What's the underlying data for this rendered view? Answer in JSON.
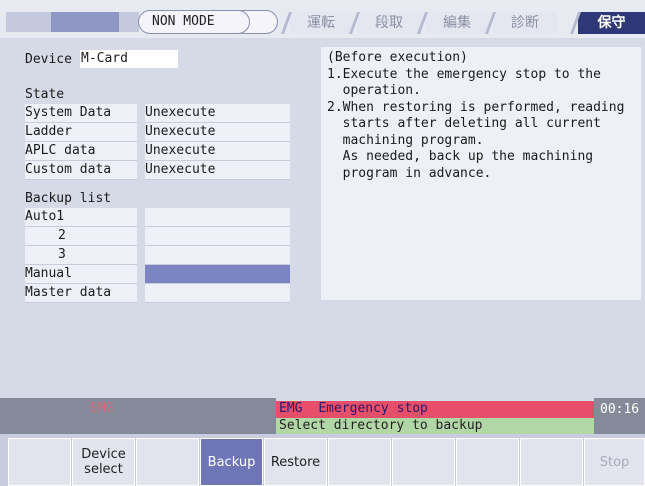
{
  "header": {
    "mode": "NON MODE",
    "tabs": [
      "運転",
      "段取",
      "編集",
      "診断",
      "保守"
    ],
    "active_tab": "保守"
  },
  "device": {
    "label": "Device",
    "value": "M-Card"
  },
  "state": {
    "title": "State",
    "rows": [
      {
        "label": "System Data",
        "value": "Unexecute"
      },
      {
        "label": "Ladder",
        "value": "Unexecute"
      },
      {
        "label": "APLC data",
        "value": "Unexecute"
      },
      {
        "label": "Custom data",
        "value": "Unexecute"
      }
    ]
  },
  "backup_list": {
    "title": "Backup list",
    "rows": [
      {
        "label": "Auto1",
        "value": ""
      },
      {
        "label": "2",
        "value": ""
      },
      {
        "label": "3",
        "value": ""
      },
      {
        "label": "Manual",
        "value": ""
      },
      {
        "label": "Master data",
        "value": ""
      }
    ],
    "selected_index": 3
  },
  "info": {
    "text": "(Before execution)\n1.Execute the emergency stop to the\n  operation.\n2.When restoring is performed, reading\n  starts after deleting all current\n  machining program.\n  As needed, back up the machining\n  program in advance."
  },
  "status": {
    "emg_dim": "EMG",
    "alarm_code": "EMG",
    "alarm_text": "Emergency stop",
    "message": "Select directory to backup",
    "time": "00:16"
  },
  "softkeys": [
    "",
    "Device\nselect",
    "",
    "Backup",
    "Restore",
    "",
    "",
    "",
    "",
    "Stop"
  ],
  "colors": {
    "alarm": "#e64e69",
    "message": "#b1d7a6",
    "active_tab": "#2e3878",
    "selected_key": "#6e76b8"
  }
}
